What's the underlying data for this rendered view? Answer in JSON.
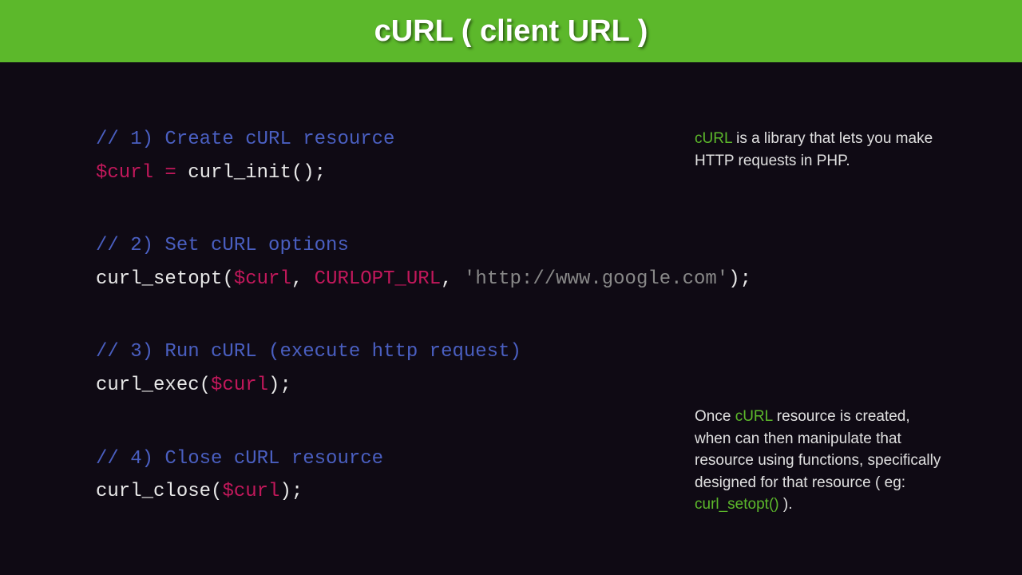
{
  "header": {
    "title": "cURL ( client URL )"
  },
  "code": {
    "block1": {
      "comment": "// 1) Create cURL resource",
      "var": "$curl",
      "eq": " = ",
      "fn": "curl_init",
      "parens": "();"
    },
    "block2": {
      "comment": "// 2) Set cURL options",
      "fn": "curl_setopt",
      "open": "(",
      "arg1": "$curl",
      "comma1": ", ",
      "arg2": "CURLOPT_URL",
      "comma2": ", ",
      "str": "'http://www.google.com'",
      "close": ");"
    },
    "block3": {
      "comment": "// 3) Run cURL (execute http request)",
      "fn": "curl_exec",
      "open": "(",
      "arg1": "$curl",
      "close": ");"
    },
    "block4": {
      "comment": "// 4) Close cURL resource",
      "fn": "curl_close",
      "open": "(",
      "arg1": "$curl",
      "close": ");"
    }
  },
  "notes": {
    "top": {
      "hl": "cURL",
      "rest": " is a library that lets you make HTTP requests in PHP."
    },
    "bottom": {
      "part1": "Once ",
      "hl1": "cURL",
      "part2": " resource is created, when can then manipulate that resource using functions, specifically designed for that resource ( eg: ",
      "hl2": "curl_setopt()",
      "part3": " )."
    }
  }
}
